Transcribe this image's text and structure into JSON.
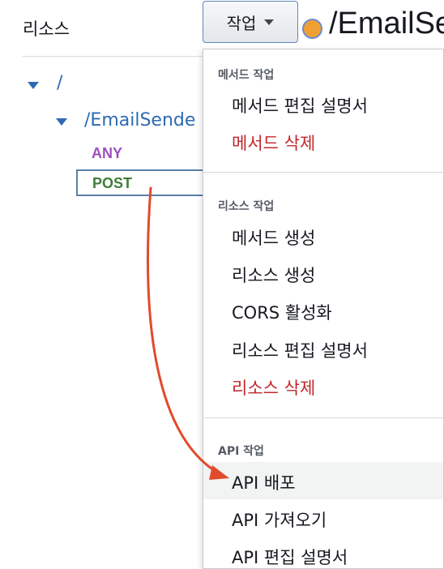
{
  "sidebar": {
    "title": "리소스",
    "root_path": "/",
    "child_path": "/EmailSende",
    "methods": [
      "ANY",
      "POST"
    ]
  },
  "actions_button": {
    "label": "작업"
  },
  "header": {
    "path": "/EmailSe"
  },
  "menu": {
    "groups": [
      {
        "title": "메서드 작업",
        "items": [
          {
            "label": "메서드 편집 설명서"
          },
          {
            "label": "메서드 삭제"
          }
        ]
      },
      {
        "title": "리소스 작업",
        "items": [
          {
            "label": "메서드 생성"
          },
          {
            "label": "리소스 생성"
          },
          {
            "label": "CORS 활성화"
          },
          {
            "label": "리소스 편집 설명서"
          },
          {
            "label": "리소스 삭제"
          }
        ]
      },
      {
        "title": "API 작업",
        "items": [
          {
            "label": "API 배포"
          },
          {
            "label": "API 가져오기"
          },
          {
            "label": "API 편집 설명서"
          }
        ]
      }
    ]
  },
  "colors": {
    "any_method": "#9d4dc2",
    "post_method": "#3f7d3a",
    "danger": "#c0272d",
    "link": "#2e6ab3",
    "annotation_arrow": "#e24a2d"
  }
}
